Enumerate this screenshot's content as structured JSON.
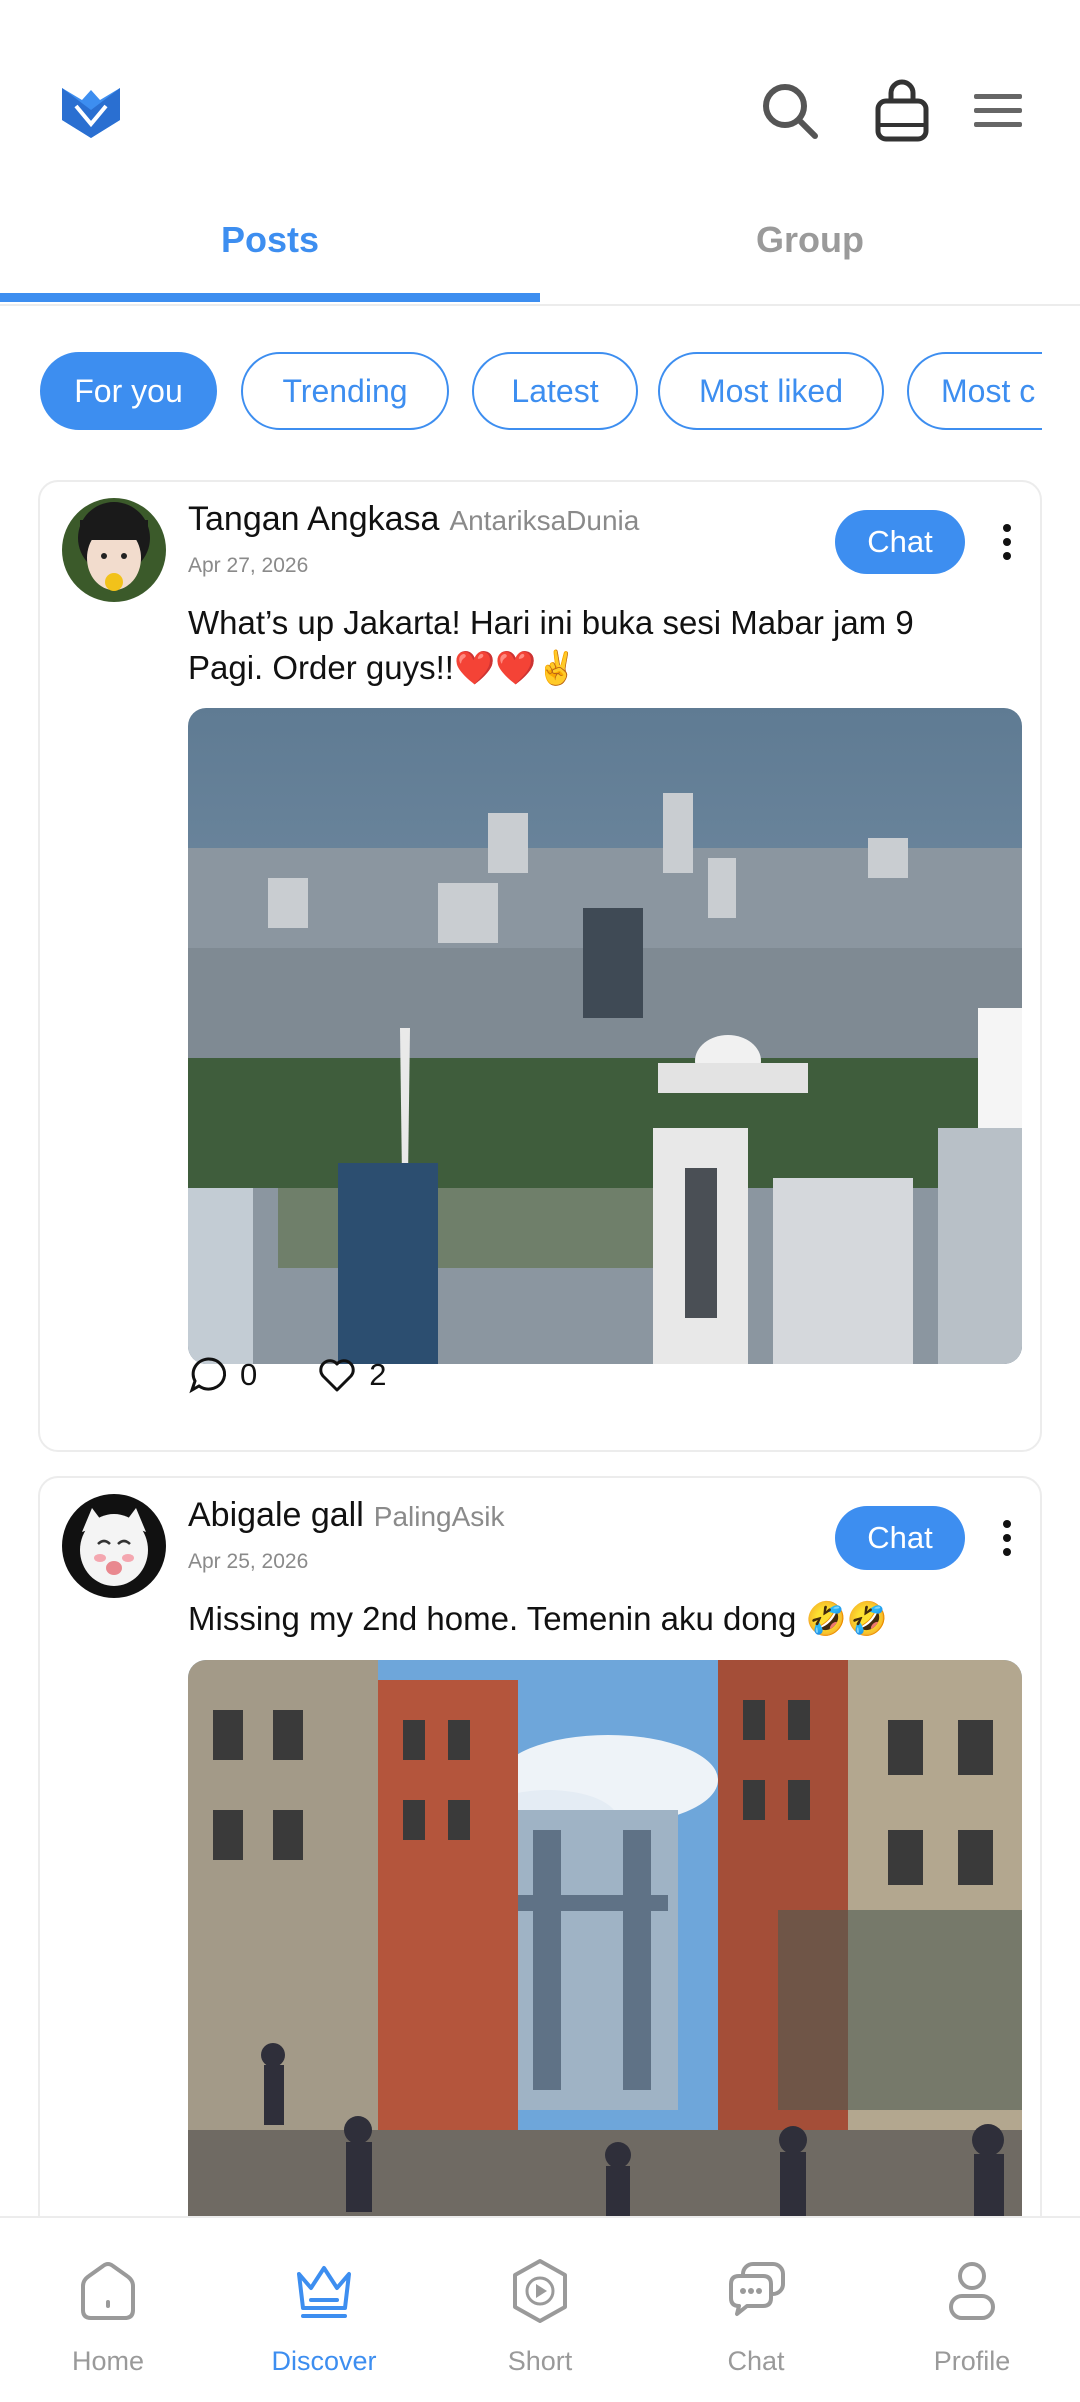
{
  "header": {
    "logo_icon": "brand-logo-icon",
    "search_icon": "search-icon",
    "bag_icon": "shopping-bag-icon",
    "menu_icon": "menu-icon"
  },
  "tabs": [
    {
      "label": "Posts",
      "active": true
    },
    {
      "label": "Group",
      "active": false
    }
  ],
  "filters": [
    {
      "label": "For you",
      "active": true
    },
    {
      "label": "Trending",
      "active": false
    },
    {
      "label": "Latest",
      "active": false
    },
    {
      "label": "Most liked",
      "active": false
    },
    {
      "label": "Most c",
      "active": false
    }
  ],
  "posts": [
    {
      "author": "Tangan Angkasa",
      "handle": "AntariksaDunia",
      "date": "Apr 27, 2026",
      "chat_label": "Chat",
      "text_line1": "What’s up Jakarta! Hari ini buka sesi Mabar jam 9",
      "text_line2": "Pagi. Order guys!!❤️❤️✌️",
      "comments": "0",
      "likes": "2"
    },
    {
      "author": "Abigale gall",
      "handle": "PalingAsik",
      "date": "Apr 25, 2026",
      "chat_label": "Chat",
      "text_line1": "Missing my 2nd home. Temenin aku dong 🤣🤣"
    }
  ],
  "bottom_nav": [
    {
      "label": "Home",
      "icon": "home-icon",
      "active": false
    },
    {
      "label": "Discover",
      "icon": "crown-icon",
      "active": true
    },
    {
      "label": "Short",
      "icon": "play-icon",
      "active": false
    },
    {
      "label": "Chat",
      "icon": "chat-bubbles-icon",
      "active": false
    },
    {
      "label": "Profile",
      "icon": "profile-icon",
      "active": false
    }
  ],
  "colors": {
    "accent": "#3d8ef0",
    "muted": "#9a9a9a"
  }
}
